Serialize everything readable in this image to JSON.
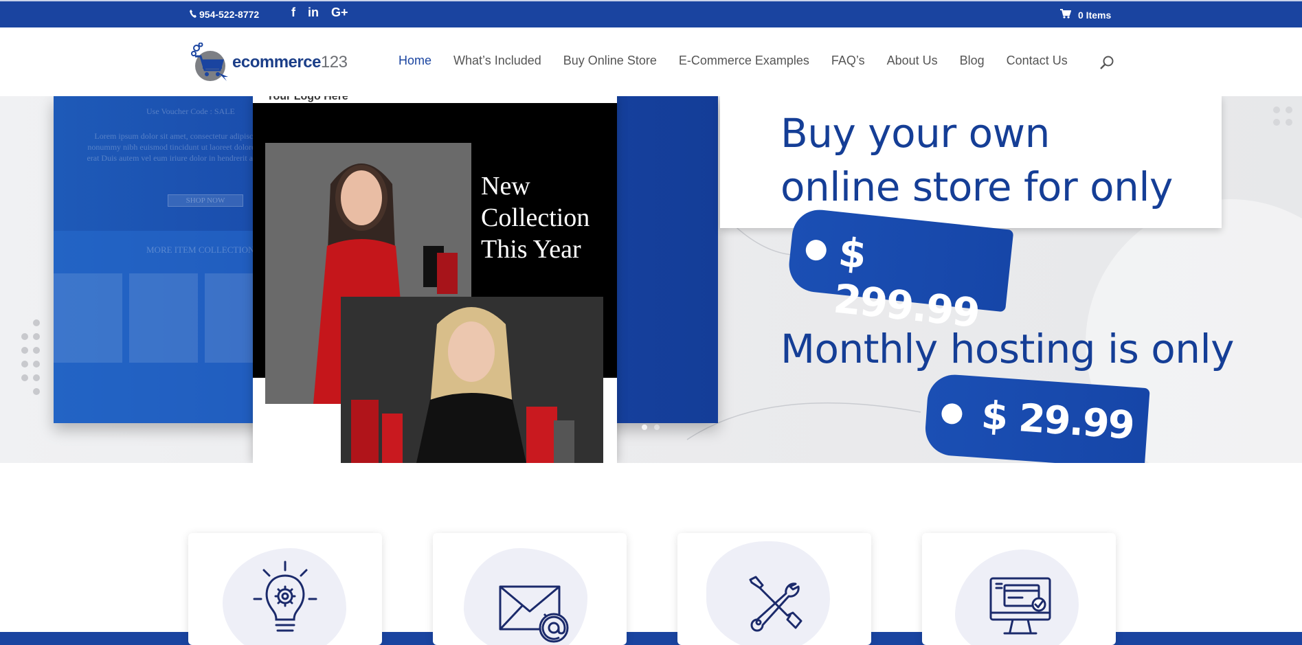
{
  "topbar": {
    "phone": "954-522-8772",
    "social": [
      {
        "icon": "facebook-icon",
        "glyph": "f"
      },
      {
        "icon": "linkedin-icon",
        "glyph": "in"
      },
      {
        "icon": "google-plus-icon",
        "glyph": "G+"
      }
    ],
    "cart": "0 Items",
    "accent": "#1a44a0"
  },
  "header": {
    "logo_text_main": "ecommerce",
    "logo_text_num": "123",
    "nav": [
      "Home",
      "What’s Included",
      "Buy Online Store",
      "E-Commerce Examples",
      "FAQ’s",
      "About Us",
      "Blog",
      "Contact Us"
    ],
    "active_nav": "Home"
  },
  "hero": {
    "phone_card_text": "New Collection This Year",
    "headline": "Buy your own",
    "headline2": "online store for only",
    "price1": "$ 299.99",
    "subheadline": "Monthly hosting is only",
    "price2": "$ 29.99",
    "background_logo_text": "Your Logo Here",
    "background_button": "SHOP NOW",
    "background_more": "MORE ITEM COLLECTION",
    "background_voucher": "Use Voucher Code : SALE",
    "background_lorem": "Lorem ipsum dolor sit amet, consectetur adipiscing elit sed diam nonummy nibh euismod tincidunt ut laoreet dolore magna aliquam erat Duis autem vel eum iriure dolor in hendrerit accumsan et iusto sim",
    "slide_count": 2,
    "active_slide": 1
  },
  "features": [
    {
      "icon": "lightbulb-gear-icon"
    },
    {
      "icon": "email-at-icon"
    },
    {
      "icon": "tools-icon"
    },
    {
      "icon": "monitor-payment-icon"
    }
  ]
}
